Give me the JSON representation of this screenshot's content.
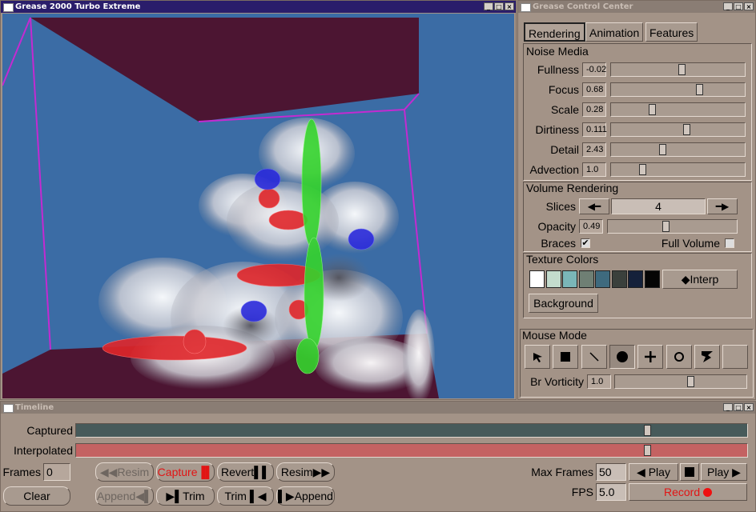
{
  "viewport_window": {
    "title": "Grease 2000 Turbo Extreme",
    "buttons": [
      "_",
      "□",
      "×"
    ]
  },
  "control_window": {
    "title": "Grease Control Center",
    "buttons": [
      "_",
      "□",
      "×"
    ],
    "tabs": [
      {
        "label": "Rendering",
        "active": true
      },
      {
        "label": "Animation",
        "active": false
      },
      {
        "label": "Features",
        "active": false
      }
    ],
    "noise_media": {
      "heading": "Noise Media",
      "rows": [
        {
          "label": "Fullness",
          "value": "-0.02",
          "fraction": 0.53
        },
        {
          "label": "Focus",
          "value": "0.68",
          "fraction": 0.67
        },
        {
          "label": "Scale",
          "value": "0.28",
          "fraction": 0.3
        },
        {
          "label": "Dirtiness",
          "value": "0.111",
          "fraction": 0.57
        },
        {
          "label": "Detail",
          "value": "2.43",
          "fraction": 0.38
        },
        {
          "label": "Advection",
          "value": "1.0",
          "fraction": 0.22
        }
      ]
    },
    "volume_rendering": {
      "heading": "Volume Rendering",
      "slices_label": "Slices",
      "slices_value": "4",
      "opacity_label": "Opacity",
      "opacity_value": "0.49",
      "opacity_fraction": 0.45,
      "braces_label": "Braces",
      "braces_checked": true,
      "full_volume_label": "Full Volume",
      "full_volume_checked": false
    },
    "texture_colors": {
      "heading": "Texture Colors",
      "swatches": [
        "#ffffff",
        "#c3dccd",
        "#7ab6b8",
        "#6f7f74",
        "#3e6a7e",
        "#3a403c",
        "#15213a",
        "#050505"
      ],
      "interp_label": "Interp",
      "background_label": "Background"
    },
    "mouse_mode": {
      "heading": "Mouse Mode",
      "tools": [
        "pointer-icon",
        "square-icon",
        "line-icon",
        "circle-icon",
        "plus-icon",
        "ring-icon",
        "vortex-icon",
        "blank-icon"
      ],
      "selected_tool": 3,
      "br_vorticity_label": "Br Vorticity",
      "br_vorticity_value": "1.0",
      "br_vorticity_fraction": 0.58
    }
  },
  "timeline_window": {
    "title": "Timeline",
    "buttons": [
      "_",
      "□",
      "×"
    ],
    "captured_label": "Captured",
    "captured_fraction": 0.85,
    "captured_color": "#475a5a",
    "interpolated_label": "Interpolated",
    "interpolated_fraction": 0.85,
    "interpolated_color": "#c46262",
    "frames_label": "Frames",
    "frames_value": "0",
    "clear_label": "Clear",
    "resim_back_label": "Resim",
    "capture_label": "Capture",
    "revert_label": "Revert",
    "resim_fwd_label": "Resim",
    "append_back_label": "Append",
    "trim_left_label": "Trim",
    "trim_right_label": "Trim",
    "append_fwd_label": "Append",
    "max_frames_label": "Max Frames",
    "max_frames_value": "50",
    "play_back_label": "Play",
    "play_fwd_label": "Play",
    "fps_label": "FPS",
    "fps_value": "5.0",
    "record_label": "Record"
  }
}
